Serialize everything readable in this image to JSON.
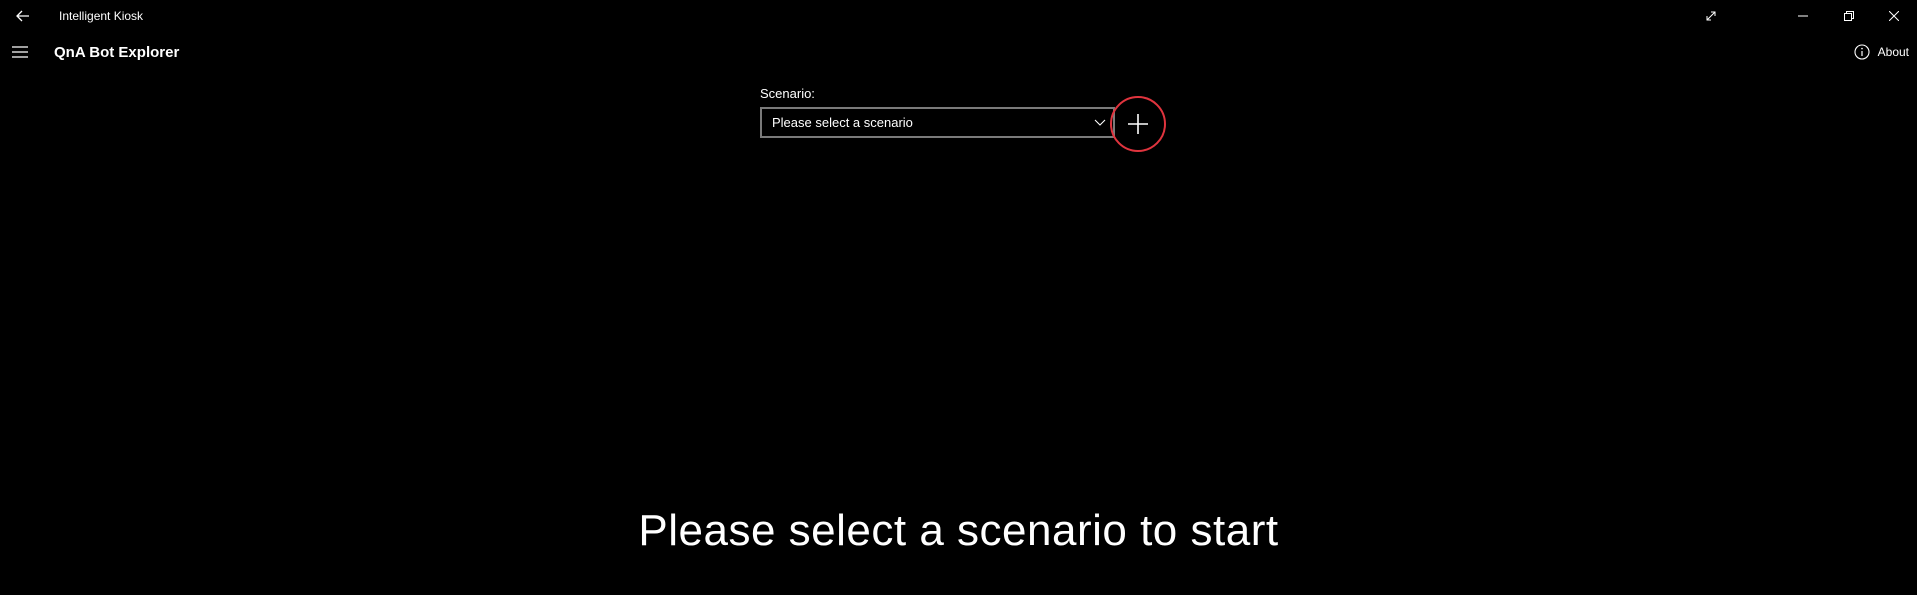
{
  "window": {
    "app_title": "Intelligent Kiosk",
    "back_icon": "back-arrow-icon",
    "controls": [
      "fullscreen-icon",
      "minimize-icon",
      "restore-icon",
      "close-icon"
    ]
  },
  "header": {
    "menu_icon": "hamburger-icon",
    "title": "QnA Bot Explorer",
    "about_label": "About",
    "about_icon": "info-icon"
  },
  "scenario": {
    "label": "Scenario:",
    "selected": "Please select a scenario",
    "add_icon": "plus-icon",
    "add_highlight_color": "#e0343e"
  },
  "main": {
    "message": "Please select a scenario to start"
  }
}
